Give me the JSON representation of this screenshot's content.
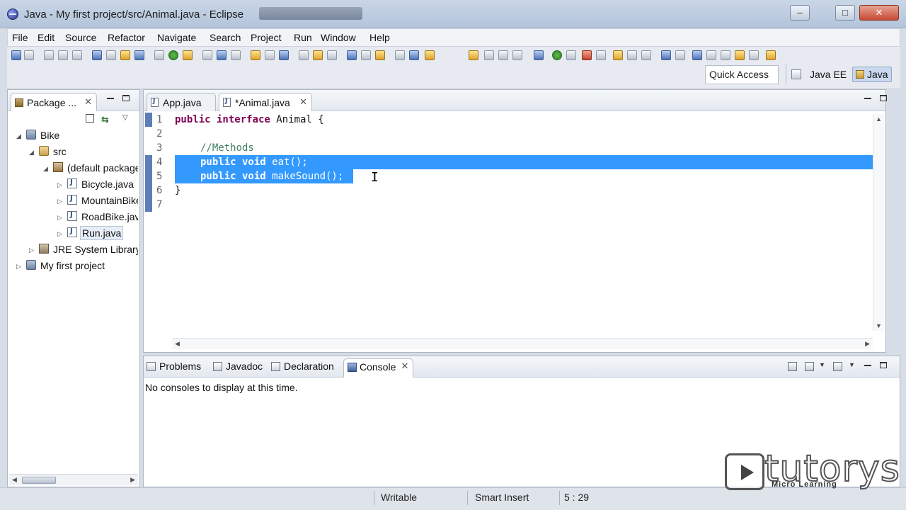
{
  "window": {
    "title": "Java - My first project/src/Animal.java - Eclipse",
    "minimize_glyph": "‒",
    "maximize_glyph": "□",
    "close_glyph": "✕"
  },
  "menu": [
    "File",
    "Edit",
    "Source",
    "Refactor",
    "Navigate",
    "Search",
    "Project",
    "Run",
    "Window",
    "Help"
  ],
  "toolbar": {
    "quick_access": "Quick Access",
    "perspectives": [
      "Java EE",
      "Java"
    ],
    "active_perspective": "Java"
  },
  "package_explorer": {
    "tab_label": "Package ...",
    "tab_close": "✕",
    "tree": [
      {
        "label": "Bike",
        "icon": "project-icon",
        "expanded": true
      },
      {
        "label": "src",
        "icon": "source-folder-icon",
        "expanded": true
      },
      {
        "label": "(default package)",
        "icon": "package-icon",
        "expanded": true
      },
      {
        "label": "Bicycle.java",
        "icon": "java-file-icon"
      },
      {
        "label": "MountainBike.java",
        "icon": "java-file-icon"
      },
      {
        "label": "RoadBike.java",
        "icon": "java-file-icon"
      },
      {
        "label": "Run.java",
        "icon": "java-file-icon",
        "selected": true
      },
      {
        "label": "JRE System Library",
        "icon": "library-icon"
      },
      {
        "label": "My first project",
        "icon": "project-icon"
      }
    ],
    "arrows": {
      "expanded": "◢",
      "collapsed": "▷"
    }
  },
  "editor": {
    "tabs": [
      {
        "label": "App.java",
        "active": false
      },
      {
        "label": "*Animal.java",
        "active": true
      }
    ],
    "tab_close": "✕",
    "line_numbers": [
      "1",
      "2",
      "3",
      "4",
      "5",
      "6",
      "7"
    ],
    "code": {
      "l1_kw": "public interface",
      "l1_rest": " Animal {",
      "l3": "//Methods",
      "l4_kw": "public void",
      "l4_rest": " eat();",
      "l5_kw": "public void",
      "l5_rest": " makeSound();",
      "l6": "}"
    },
    "selection_color": "#3399ff"
  },
  "bottom_panel": {
    "tabs": [
      "Problems",
      "Javadoc",
      "Declaration",
      "Console"
    ],
    "active_tab": "Console",
    "tab_close": "✕",
    "message": "No consoles to display at this time."
  },
  "status_bar": {
    "mode": "Writable",
    "insert": "Smart Insert",
    "position": "5 : 29"
  },
  "watermark": {
    "brand": "tutorys",
    "tagline": "Micro Learning"
  },
  "colors": {
    "keyword": "#7f0055",
    "comment": "#3f7f5f",
    "selection": "#3399ff"
  }
}
